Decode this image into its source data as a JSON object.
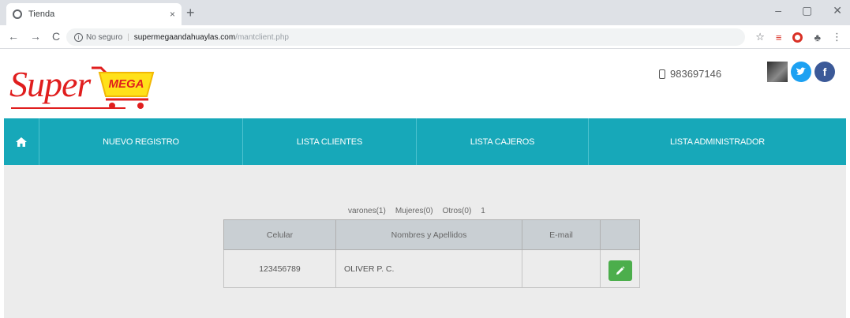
{
  "browser": {
    "tab_title": "Tienda",
    "tab_close": "×",
    "new_tab": "+",
    "win_min": "–",
    "win_max": "▢",
    "win_close": "✕",
    "nav_back": "←",
    "nav_forward": "→",
    "nav_reload": "C",
    "security_text": "No seguro",
    "url_domain": "supermegaandahuaylas.com",
    "url_path": "/mantclient.php",
    "star": "☆",
    "menu": "⋮"
  },
  "header": {
    "logo_text": "Super",
    "logo_cart_text": "MEGA",
    "phone": "983697146"
  },
  "nav": {
    "items": [
      {
        "label": "NUEVO REGISTRO"
      },
      {
        "label": "LISTA CLIENTES"
      },
      {
        "label": "LISTA CAJEROS"
      },
      {
        "label": "LISTA ADMINISTRADOR"
      }
    ]
  },
  "content": {
    "stats": {
      "varones": "varones(1)",
      "mujeres": "Mujeres(0)",
      "otros": "Otros(0)",
      "total": "1"
    },
    "table": {
      "headers": [
        "Celular",
        "Nombres y Apellidos",
        "E-mail",
        ""
      ],
      "rows": [
        {
          "celular": "123456789",
          "nombres": "OLIVER P. C.",
          "email": ""
        }
      ]
    }
  },
  "colors": {
    "nav_bg": "#17a8b9",
    "logo_red": "#e01e1e",
    "edit_green": "#4cae4c"
  }
}
